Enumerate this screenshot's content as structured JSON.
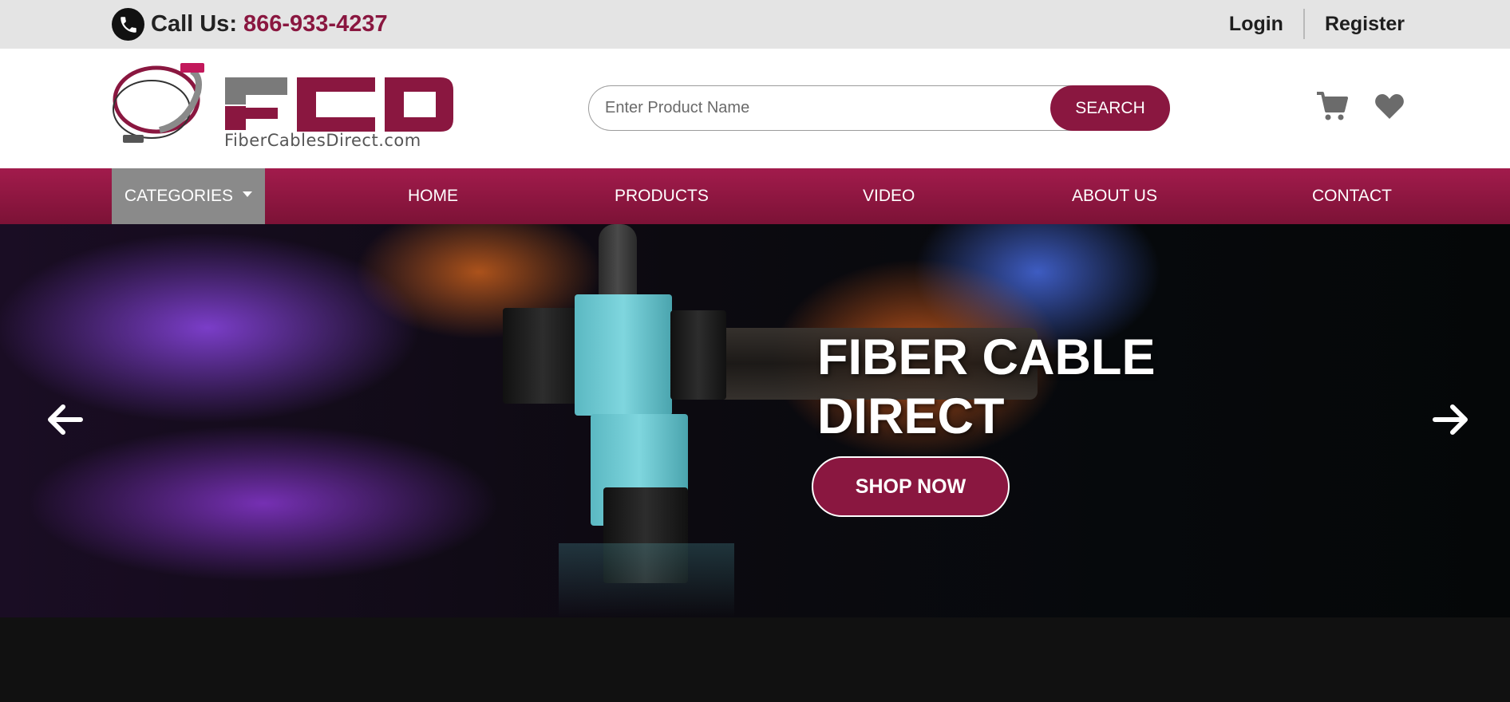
{
  "topbar": {
    "call_label": "Call Us:",
    "phone_number": "866-933-4237",
    "login": "Login",
    "register": "Register"
  },
  "header": {
    "logo_text": "FCD",
    "logo_subtext": "FiberCablesDirect.com",
    "search_placeholder": "Enter Product Name",
    "search_button": "SEARCH"
  },
  "nav": {
    "categories": "CATEGORIES",
    "items": [
      "HOME",
      "PRODUCTS",
      "VIDEO",
      "ABOUT US",
      "CONTACT"
    ]
  },
  "hero": {
    "title_line1": "FIBER CABLE",
    "title_line2": "DIRECT",
    "cta": "SHOP NOW"
  },
  "colors": {
    "brand": "#8a1740",
    "topbar_bg": "#e4e4e4",
    "category_bg": "#8a8a8a"
  },
  "icons": [
    "phone-icon",
    "cart-icon",
    "heart-icon",
    "arrow-left-icon",
    "arrow-right-icon",
    "caret-down-icon"
  ]
}
